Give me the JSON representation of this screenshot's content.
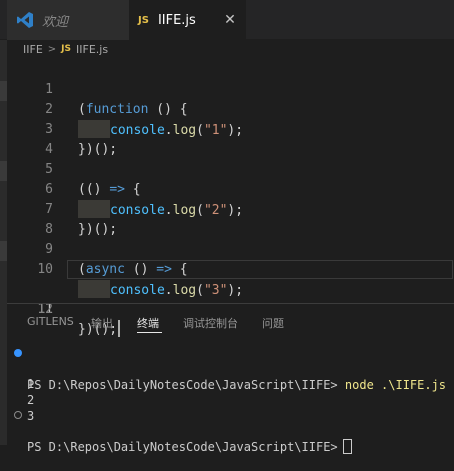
{
  "tabs": [
    {
      "label": "欢迎",
      "icon": "vscode-icon",
      "active": false
    },
    {
      "label": "IIFE.js",
      "icon": "js-icon",
      "active": true
    }
  ],
  "close_glyph": "✕",
  "breadcrumb": {
    "folder": "IIFE",
    "separator": ">",
    "file_icon": "JS",
    "file": "IIFE.js"
  },
  "editor": {
    "current_line": 11,
    "lines": [
      {
        "n": "1"
      },
      {
        "n": "2"
      },
      {
        "n": "3"
      },
      {
        "n": "4"
      },
      {
        "n": "5"
      },
      {
        "n": "6"
      },
      {
        "n": "7"
      },
      {
        "n": "8"
      },
      {
        "n": "9"
      },
      {
        "n": "10"
      },
      {
        "n": "11"
      },
      {
        "n": "12"
      }
    ],
    "tokens": {
      "l1_open": "(",
      "l1_kw": "function",
      "l1_rest": " () {",
      "l2_obj": "console",
      "l2_dot": ".",
      "l2_fn": "log",
      "l2_paren": "(",
      "l2_str": "\"1\"",
      "l2_end": ");",
      "l3": "})();",
      "l5_open": "((",
      "l5_rest": ") ",
      "l5_arrow": "=>",
      "l5_brace": " {",
      "l6_obj": "console",
      "l6_dot": ".",
      "l6_fn": "log",
      "l6_paren": "(",
      "l6_str": "\"2\"",
      "l6_end": ");",
      "l7": "})();",
      "l9_open": "(",
      "l9_kw": "async",
      "l9_rest": " () ",
      "l9_arrow": "=>",
      "l9_brace": " {",
      "l10_obj": "console",
      "l10_dot": ".",
      "l10_fn": "log",
      "l10_paren": "(",
      "l10_str": "\"3\"",
      "l10_end": ");",
      "l11": "})();"
    }
  },
  "panel": {
    "tabs": [
      "GITLENS",
      "输出",
      "终端",
      "调试控制台",
      "问题"
    ],
    "active_tab": "终端"
  },
  "terminal": {
    "prompt1": "PS D:\\Repos\\DailyNotesCode\\JavaScript\\IIFE> ",
    "command": "node .\\IIFE.js",
    "outputs": [
      "1",
      "2",
      "3"
    ],
    "prompt2": "PS D:\\Repos\\DailyNotesCode\\JavaScript\\IIFE>"
  },
  "colors": {
    "background": "#1e1e1e",
    "keyword": "#569cd6",
    "function": "#dcdcaa",
    "object": "#4fc1ff",
    "string": "#ce9178",
    "js_icon": "#e5c04a",
    "terminal_dot": "#3794ff"
  }
}
